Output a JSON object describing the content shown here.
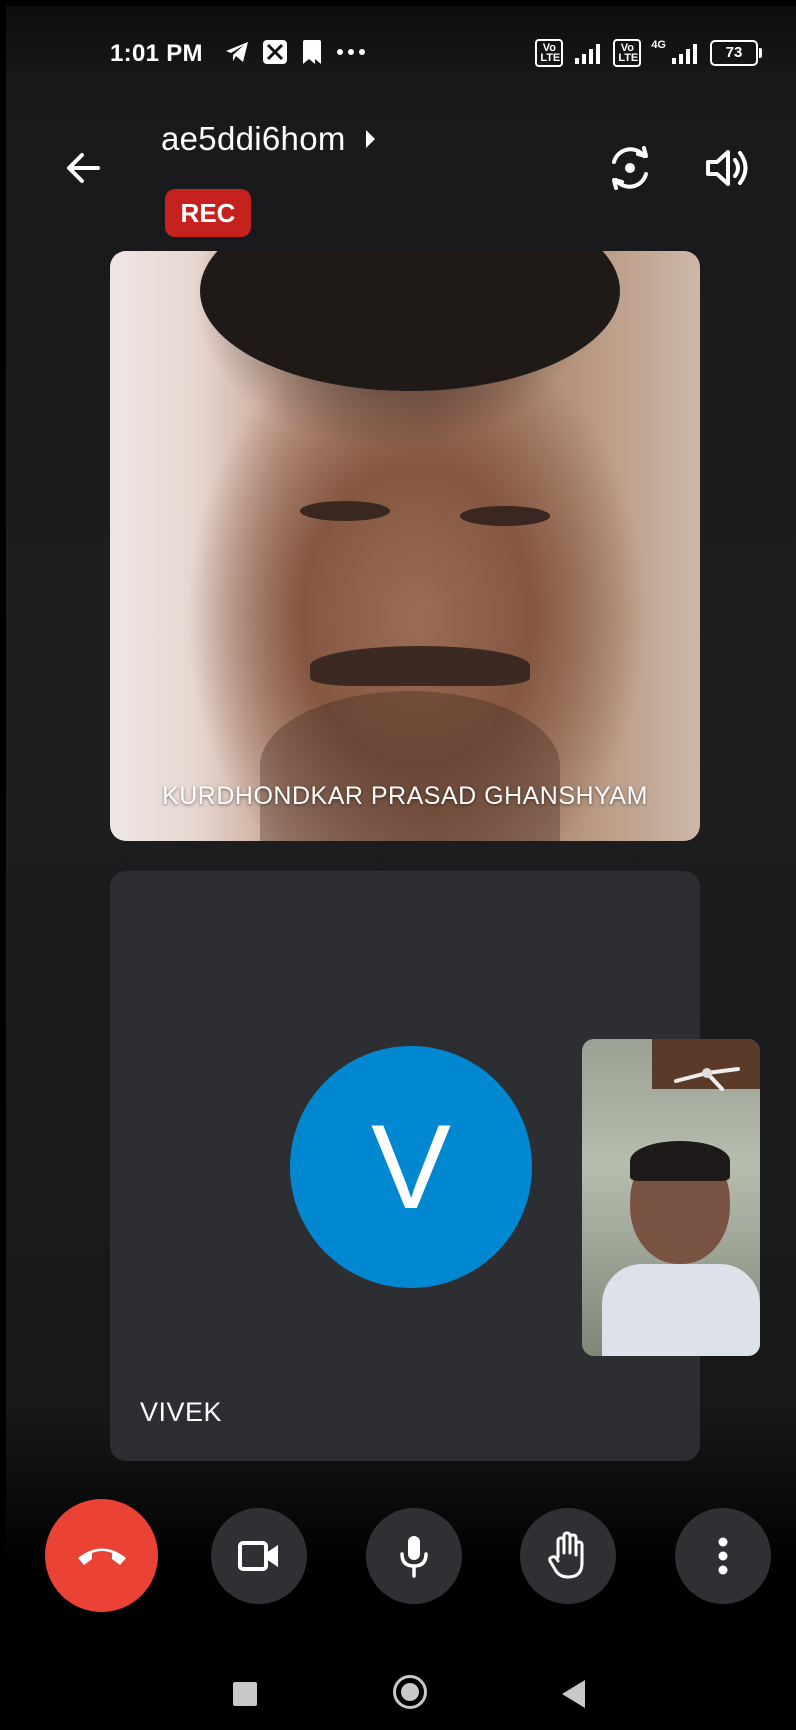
{
  "status_bar": {
    "time": "1:01 PM",
    "notification_icons": [
      "telegram-icon",
      "app-icon",
      "bookmark-icon",
      "more-notifications-icon"
    ],
    "network_badge_1": "Vo LTE",
    "network_badge_2": "Vo LTE",
    "network_type": "4G",
    "battery_level": "73"
  },
  "header": {
    "meeting_code": "ae5ddi6hom",
    "rec_label": "REC"
  },
  "participants": {
    "main_tile_name": "KURDHONDKAR PRASAD GHANSHYAM",
    "second_tile_name": "VIVEK",
    "second_tile_initial": "V"
  },
  "colors": {
    "end_call": "#ea4335",
    "rec": "#c5221f",
    "avatar": "#0288d1",
    "control_bg": "#2f3033",
    "tile_bg": "#2d2e31"
  },
  "controls": [
    "end-call-icon",
    "camera-icon",
    "microphone-icon",
    "raise-hand-icon",
    "more-options-icon"
  ]
}
